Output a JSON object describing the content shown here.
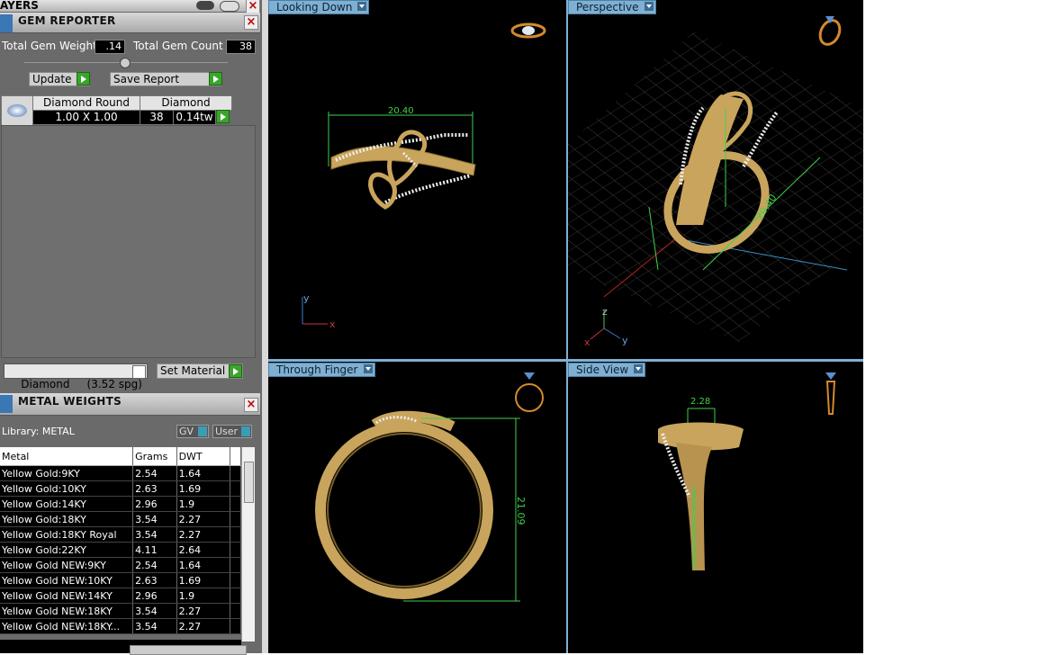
{
  "layers": {
    "title": "AYERS"
  },
  "gem_reporter": {
    "title": "GEM REPORTER",
    "total_weight_label": "Total Gem Weight",
    "total_weight_value": ".14",
    "total_count_label": "Total Gem Count",
    "total_count_value": "38",
    "update_label": "Update",
    "save_report_label": "Save Report",
    "table_headers": [
      "Diamond Round",
      "Diamond"
    ],
    "row": {
      "size": "1.00 X 1.00",
      "count": "38",
      "weight": "0.14tw"
    },
    "material_value": "Diamond     (3.52 spg)",
    "set_material_label": "Set Material"
  },
  "metal_weights": {
    "title": "METAL WEIGHTS",
    "library_label": "Library: METAL",
    "gv_label": "GV",
    "user_label": "User",
    "headers": [
      "Metal",
      "Grams",
      "DWT"
    ],
    "rows": [
      [
        "Yellow Gold:9KY",
        "2.54",
        "1.64"
      ],
      [
        "Yellow Gold:10KY",
        "2.63",
        "1.69"
      ],
      [
        "Yellow Gold:14KY",
        "2.96",
        "1.9"
      ],
      [
        "Yellow Gold:18KY",
        "3.54",
        "2.27"
      ],
      [
        "Yellow Gold:18KY Royal",
        "3.54",
        "2.27"
      ],
      [
        "Yellow Gold:22KY",
        "4.11",
        "2.64"
      ],
      [
        "Yellow Gold NEW:9KY",
        "2.54",
        "1.64"
      ],
      [
        "Yellow Gold NEW:10KY",
        "2.63",
        "1.69"
      ],
      [
        "Yellow Gold NEW:14KY",
        "2.96",
        "1.9"
      ],
      [
        "Yellow Gold NEW:18KY",
        "3.54",
        "2.27"
      ],
      [
        "Yellow Gold NEW:18KY...",
        "3.54",
        "2.27"
      ]
    ]
  },
  "viewports": {
    "top_left": {
      "label": "Looking Down",
      "dimension": "20.40",
      "axis_y": "y",
      "axis_x": "x"
    },
    "top_right": {
      "label": "Perspective",
      "dimension": "20.40",
      "axis_z": "z",
      "axis_x": "x",
      "axis_y": "y"
    },
    "bottom_left": {
      "label": "Through Finger",
      "dimension": "21.09"
    },
    "bottom_right": {
      "label": "Side View",
      "dimension": "2.28"
    }
  },
  "colors": {
    "gold": "#c9a45c",
    "dimension_green": "#3fd14a",
    "viewport_label": "#7fb0d4"
  }
}
